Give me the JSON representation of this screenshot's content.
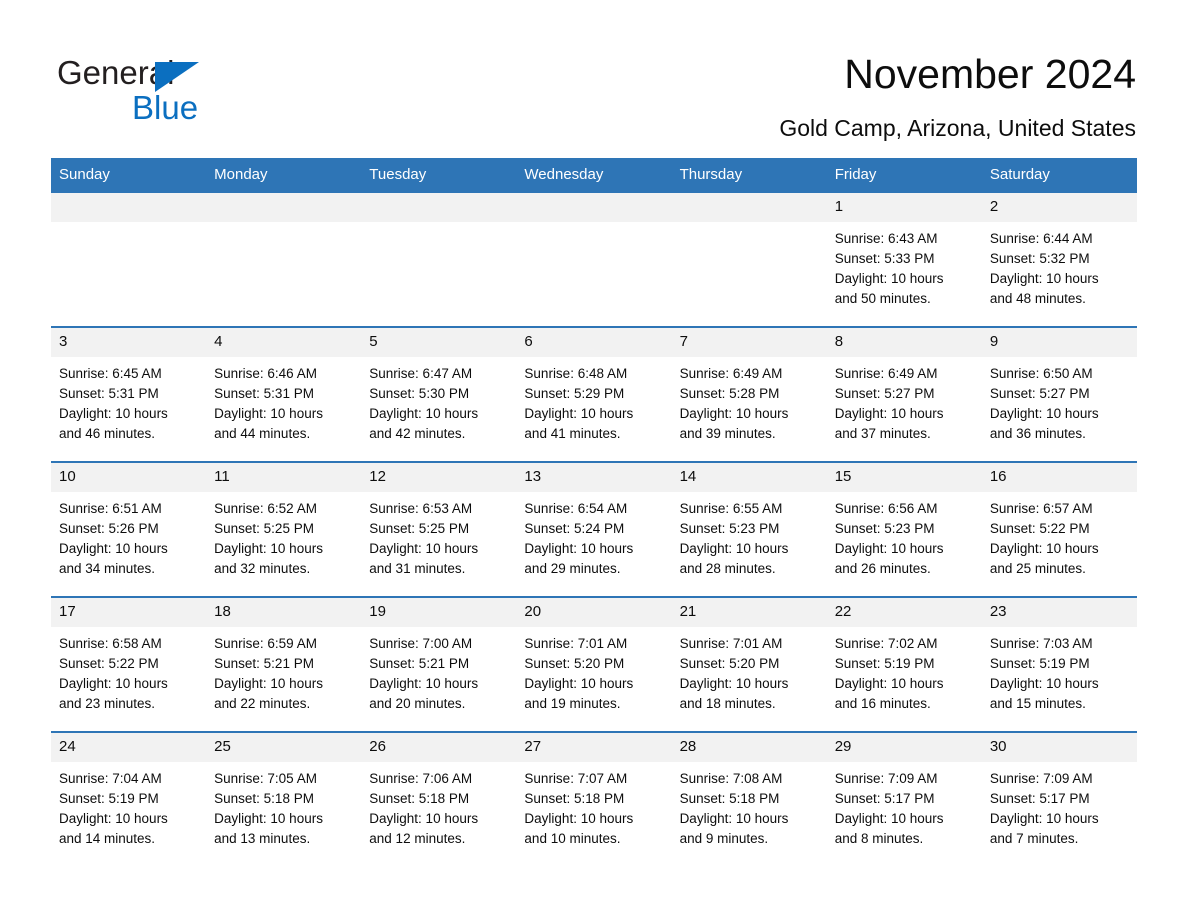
{
  "brand": {
    "name_part1": "General",
    "name_part2": "Blue",
    "accent_color": "#0b6fc0"
  },
  "header": {
    "title": "November 2024",
    "subtitle": "Gold Camp, Arizona, United States",
    "header_bg_color": "#2e75b6",
    "daynum_bg_color": "#f2f2f2"
  },
  "weekdays": [
    "Sunday",
    "Monday",
    "Tuesday",
    "Wednesday",
    "Thursday",
    "Friday",
    "Saturday"
  ],
  "labels": {
    "sunrise_prefix": "Sunrise:",
    "sunset_prefix": "Sunset:",
    "daylight_prefix": "Daylight:"
  },
  "weeks": [
    [
      {
        "day": "",
        "sunrise": "",
        "sunset": "",
        "daylight_line1": "",
        "daylight_line2": ""
      },
      {
        "day": "",
        "sunrise": "",
        "sunset": "",
        "daylight_line1": "",
        "daylight_line2": ""
      },
      {
        "day": "",
        "sunrise": "",
        "sunset": "",
        "daylight_line1": "",
        "daylight_line2": ""
      },
      {
        "day": "",
        "sunrise": "",
        "sunset": "",
        "daylight_line1": "",
        "daylight_line2": ""
      },
      {
        "day": "",
        "sunrise": "",
        "sunset": "",
        "daylight_line1": "",
        "daylight_line2": ""
      },
      {
        "day": "1",
        "sunrise": "Sunrise: 6:43 AM",
        "sunset": "Sunset: 5:33 PM",
        "daylight_line1": "Daylight: 10 hours",
        "daylight_line2": "and 50 minutes."
      },
      {
        "day": "2",
        "sunrise": "Sunrise: 6:44 AM",
        "sunset": "Sunset: 5:32 PM",
        "daylight_line1": "Daylight: 10 hours",
        "daylight_line2": "and 48 minutes."
      }
    ],
    [
      {
        "day": "3",
        "sunrise": "Sunrise: 6:45 AM",
        "sunset": "Sunset: 5:31 PM",
        "daylight_line1": "Daylight: 10 hours",
        "daylight_line2": "and 46 minutes."
      },
      {
        "day": "4",
        "sunrise": "Sunrise: 6:46 AM",
        "sunset": "Sunset: 5:31 PM",
        "daylight_line1": "Daylight: 10 hours",
        "daylight_line2": "and 44 minutes."
      },
      {
        "day": "5",
        "sunrise": "Sunrise: 6:47 AM",
        "sunset": "Sunset: 5:30 PM",
        "daylight_line1": "Daylight: 10 hours",
        "daylight_line2": "and 42 minutes."
      },
      {
        "day": "6",
        "sunrise": "Sunrise: 6:48 AM",
        "sunset": "Sunset: 5:29 PM",
        "daylight_line1": "Daylight: 10 hours",
        "daylight_line2": "and 41 minutes."
      },
      {
        "day": "7",
        "sunrise": "Sunrise: 6:49 AM",
        "sunset": "Sunset: 5:28 PM",
        "daylight_line1": "Daylight: 10 hours",
        "daylight_line2": "and 39 minutes."
      },
      {
        "day": "8",
        "sunrise": "Sunrise: 6:49 AM",
        "sunset": "Sunset: 5:27 PM",
        "daylight_line1": "Daylight: 10 hours",
        "daylight_line2": "and 37 minutes."
      },
      {
        "day": "9",
        "sunrise": "Sunrise: 6:50 AM",
        "sunset": "Sunset: 5:27 PM",
        "daylight_line1": "Daylight: 10 hours",
        "daylight_line2": "and 36 minutes."
      }
    ],
    [
      {
        "day": "10",
        "sunrise": "Sunrise: 6:51 AM",
        "sunset": "Sunset: 5:26 PM",
        "daylight_line1": "Daylight: 10 hours",
        "daylight_line2": "and 34 minutes."
      },
      {
        "day": "11",
        "sunrise": "Sunrise: 6:52 AM",
        "sunset": "Sunset: 5:25 PM",
        "daylight_line1": "Daylight: 10 hours",
        "daylight_line2": "and 32 minutes."
      },
      {
        "day": "12",
        "sunrise": "Sunrise: 6:53 AM",
        "sunset": "Sunset: 5:25 PM",
        "daylight_line1": "Daylight: 10 hours",
        "daylight_line2": "and 31 minutes."
      },
      {
        "day": "13",
        "sunrise": "Sunrise: 6:54 AM",
        "sunset": "Sunset: 5:24 PM",
        "daylight_line1": "Daylight: 10 hours",
        "daylight_line2": "and 29 minutes."
      },
      {
        "day": "14",
        "sunrise": "Sunrise: 6:55 AM",
        "sunset": "Sunset: 5:23 PM",
        "daylight_line1": "Daylight: 10 hours",
        "daylight_line2": "and 28 minutes."
      },
      {
        "day": "15",
        "sunrise": "Sunrise: 6:56 AM",
        "sunset": "Sunset: 5:23 PM",
        "daylight_line1": "Daylight: 10 hours",
        "daylight_line2": "and 26 minutes."
      },
      {
        "day": "16",
        "sunrise": "Sunrise: 6:57 AM",
        "sunset": "Sunset: 5:22 PM",
        "daylight_line1": "Daylight: 10 hours",
        "daylight_line2": "and 25 minutes."
      }
    ],
    [
      {
        "day": "17",
        "sunrise": "Sunrise: 6:58 AM",
        "sunset": "Sunset: 5:22 PM",
        "daylight_line1": "Daylight: 10 hours",
        "daylight_line2": "and 23 minutes."
      },
      {
        "day": "18",
        "sunrise": "Sunrise: 6:59 AM",
        "sunset": "Sunset: 5:21 PM",
        "daylight_line1": "Daylight: 10 hours",
        "daylight_line2": "and 22 minutes."
      },
      {
        "day": "19",
        "sunrise": "Sunrise: 7:00 AM",
        "sunset": "Sunset: 5:21 PM",
        "daylight_line1": "Daylight: 10 hours",
        "daylight_line2": "and 20 minutes."
      },
      {
        "day": "20",
        "sunrise": "Sunrise: 7:01 AM",
        "sunset": "Sunset: 5:20 PM",
        "daylight_line1": "Daylight: 10 hours",
        "daylight_line2": "and 19 minutes."
      },
      {
        "day": "21",
        "sunrise": "Sunrise: 7:01 AM",
        "sunset": "Sunset: 5:20 PM",
        "daylight_line1": "Daylight: 10 hours",
        "daylight_line2": "and 18 minutes."
      },
      {
        "day": "22",
        "sunrise": "Sunrise: 7:02 AM",
        "sunset": "Sunset: 5:19 PM",
        "daylight_line1": "Daylight: 10 hours",
        "daylight_line2": "and 16 minutes."
      },
      {
        "day": "23",
        "sunrise": "Sunrise: 7:03 AM",
        "sunset": "Sunset: 5:19 PM",
        "daylight_line1": "Daylight: 10 hours",
        "daylight_line2": "and 15 minutes."
      }
    ],
    [
      {
        "day": "24",
        "sunrise": "Sunrise: 7:04 AM",
        "sunset": "Sunset: 5:19 PM",
        "daylight_line1": "Daylight: 10 hours",
        "daylight_line2": "and 14 minutes."
      },
      {
        "day": "25",
        "sunrise": "Sunrise: 7:05 AM",
        "sunset": "Sunset: 5:18 PM",
        "daylight_line1": "Daylight: 10 hours",
        "daylight_line2": "and 13 minutes."
      },
      {
        "day": "26",
        "sunrise": "Sunrise: 7:06 AM",
        "sunset": "Sunset: 5:18 PM",
        "daylight_line1": "Daylight: 10 hours",
        "daylight_line2": "and 12 minutes."
      },
      {
        "day": "27",
        "sunrise": "Sunrise: 7:07 AM",
        "sunset": "Sunset: 5:18 PM",
        "daylight_line1": "Daylight: 10 hours",
        "daylight_line2": "and 10 minutes."
      },
      {
        "day": "28",
        "sunrise": "Sunrise: 7:08 AM",
        "sunset": "Sunset: 5:18 PM",
        "daylight_line1": "Daylight: 10 hours",
        "daylight_line2": "and 9 minutes."
      },
      {
        "day": "29",
        "sunrise": "Sunrise: 7:09 AM",
        "sunset": "Sunset: 5:17 PM",
        "daylight_line1": "Daylight: 10 hours",
        "daylight_line2": "and 8 minutes."
      },
      {
        "day": "30",
        "sunrise": "Sunrise: 7:09 AM",
        "sunset": "Sunset: 5:17 PM",
        "daylight_line1": "Daylight: 10 hours",
        "daylight_line2": "and 7 minutes."
      }
    ]
  ]
}
